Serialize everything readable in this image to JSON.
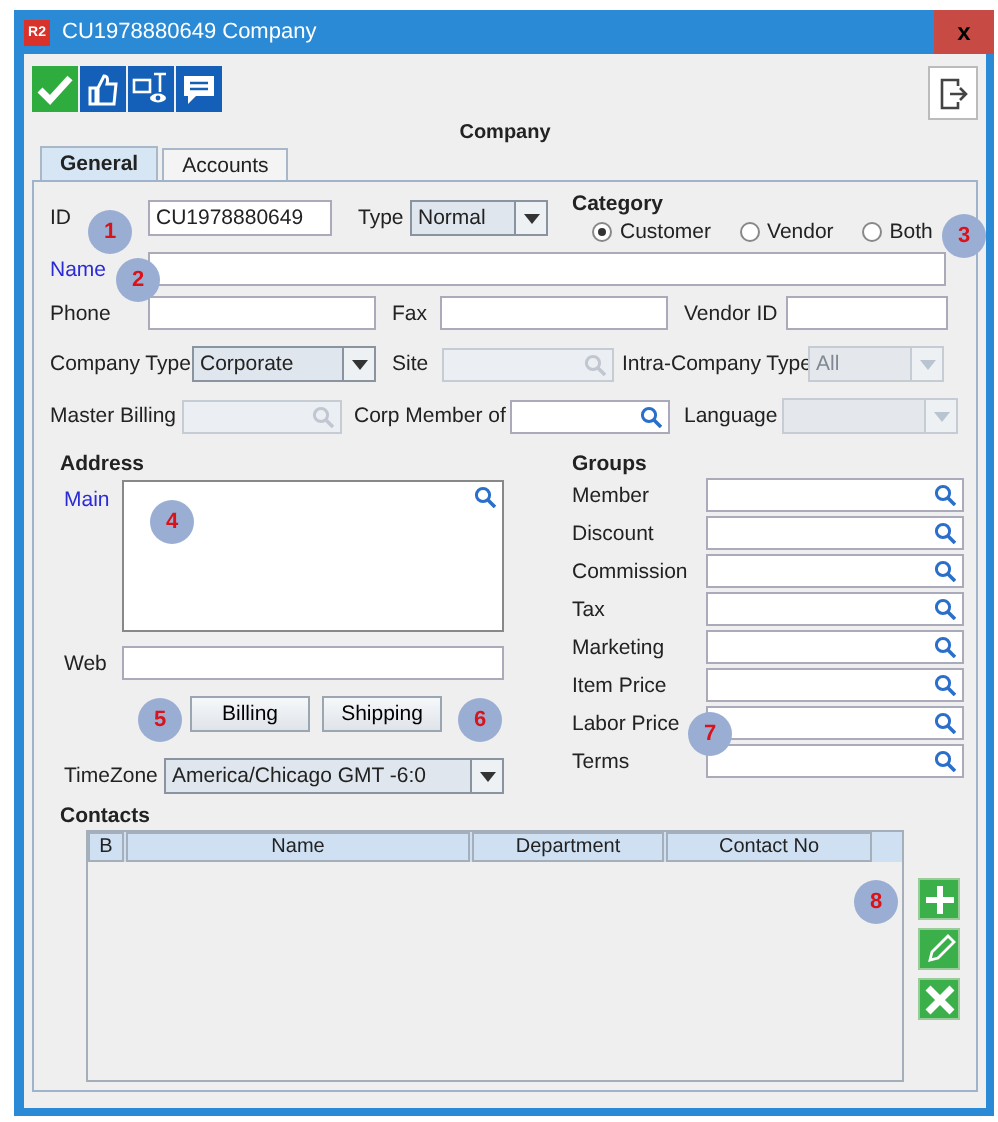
{
  "window": {
    "badge": "R2",
    "title": "CU1978880649 Company",
    "close": "x"
  },
  "heading": "Company",
  "tabs": [
    {
      "label": "General",
      "selected": true
    },
    {
      "label": "Accounts",
      "selected": false
    }
  ],
  "general": {
    "id": {
      "label": "ID",
      "value": "CU1978880649"
    },
    "type": {
      "label": "Type",
      "value": "Normal"
    },
    "category": {
      "label": "Category",
      "options": [
        {
          "label": "Customer",
          "selected": true
        },
        {
          "label": "Vendor",
          "selected": false
        },
        {
          "label": "Both",
          "selected": false
        }
      ]
    },
    "name": {
      "label": "Name"
    },
    "phone": {
      "label": "Phone"
    },
    "fax": {
      "label": "Fax"
    },
    "vendor_id": {
      "label": "Vendor ID"
    },
    "company_type": {
      "label": "Company Type",
      "value": "Corporate",
      "disabled": false
    },
    "site": {
      "label": "Site",
      "disabled": true
    },
    "intra_company_type": {
      "label": "Intra-Company Type",
      "value": "All",
      "disabled": true
    },
    "master_billing": {
      "label": "Master Billing",
      "disabled": true
    },
    "corp_member_of": {
      "label": "Corp Member of",
      "disabled": false
    },
    "language": {
      "label": "Language",
      "disabled": true
    },
    "address": {
      "title": "Address",
      "main_label": "Main",
      "web_label": "Web",
      "buttons": [
        "Billing",
        "Shipping"
      ]
    },
    "timezone": {
      "label": "TimeZone",
      "value": "America/Chicago GMT -6:0"
    },
    "groups": {
      "title": "Groups",
      "fields": [
        "Member",
        "Discount",
        "Commission",
        "Tax",
        "Marketing",
        "Item Price",
        "Labor Price",
        "Terms"
      ]
    },
    "contacts": {
      "title": "Contacts",
      "columns": [
        "B",
        "Name",
        "Department",
        "Contact No"
      ]
    }
  },
  "callouts": [
    "1",
    "2",
    "3",
    "4",
    "5",
    "6",
    "7",
    "8"
  ]
}
